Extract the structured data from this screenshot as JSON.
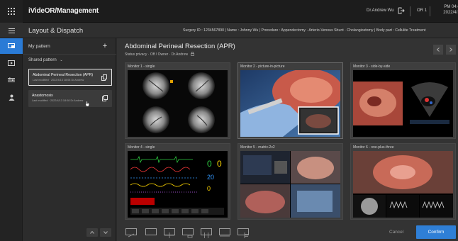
{
  "brand": "iVideOR/Management",
  "user": "Dr.Andrew Wu",
  "room": "OR 1",
  "clock": {
    "time": "PM 04:49",
    "date": "2022/4/13"
  },
  "page_title": "Layout & Dispatch",
  "patient_info": "Surgery ID : 1234567890  |  Name : Johnny Wu  |  Procedure : Appendectomy · Arterio-Venous Shunt · Cholangiostomy  |  Body part : Cellulite Treatment",
  "rail": [
    "apps-icon",
    "layout-icon",
    "video-icon",
    "settings-icon",
    "person-icon"
  ],
  "panel": {
    "my_pattern": "My pattern",
    "add": "+",
    "shared_pattern": "Shared pattern",
    "cards": [
      {
        "title": "Abdominal Perineal Resection (APR)",
        "meta": "Last modified · 2022/4/13 18:08 Dr.Andrew"
      },
      {
        "title": "Anastomosis",
        "meta": "Last modified · 2022/4/13 18:08 Dr.Andrew"
      }
    ]
  },
  "main": {
    "title": "Abdominal Perineal Resection (APR)",
    "meta": "Status privacy · Off / Owner · Dr.Andrew",
    "monitors": [
      {
        "label": "Monitor 1 - single"
      },
      {
        "label": "Monitor 2 - picture-in-picture"
      },
      {
        "label": "Monitor 3 - side-by-side"
      },
      {
        "label": "Monitor 4 - single"
      },
      {
        "label": "Monitor 5 - matrix-2x2"
      },
      {
        "label": "Monitor 6 - one-plus-three"
      }
    ],
    "cancel": "Cancel",
    "confirm": "Confirm"
  },
  "vitals": {
    "a": "0",
    "b": "0",
    "c": "20",
    "d": "0"
  },
  "colors": {
    "accent": "#2f7fd6",
    "bg": "#333333"
  }
}
